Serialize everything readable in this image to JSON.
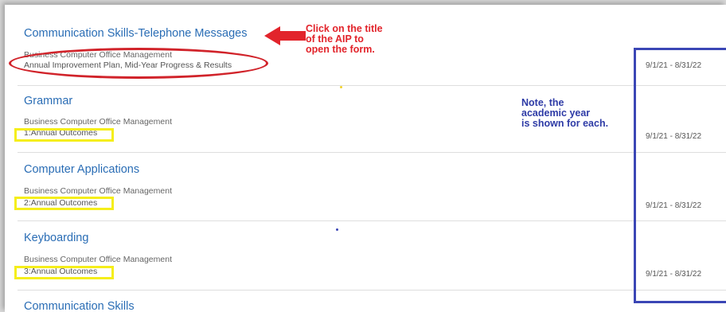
{
  "items": [
    {
      "title": "Communication Skills-Telephone Messages",
      "program": "Business Computer Office Management",
      "form": "Annual Improvement Plan, Mid-Year Progress & Results",
      "date": "9/1/21 - 8/31/22"
    },
    {
      "title": "Grammar",
      "program": "Business Computer Office Management",
      "form": "1:Annual Outcomes",
      "date": "9/1/21 - 8/31/22"
    },
    {
      "title": "Computer Applications",
      "program": "Business Computer Office Management",
      "form": "2:Annual Outcomes",
      "date": "9/1/21 - 8/31/22"
    },
    {
      "title": "Keyboarding",
      "program": "Business Computer Office Management",
      "form": "3:Annual Outcomes",
      "date": "9/1/21 - 8/31/22"
    },
    {
      "title": "Communication Skills"
    }
  ],
  "annotations": {
    "red_callout": [
      "Click on the title",
      "of the AIP to",
      "open the form."
    ],
    "blue_callout": [
      "Note, the",
      "academic year",
      "is shown for each."
    ]
  },
  "colors": {
    "link": "#2a6db5",
    "red_annotation": "#e2242b",
    "blue_annotation": "#2e3ba6",
    "yellow_highlight": "#f5ee1a"
  }
}
